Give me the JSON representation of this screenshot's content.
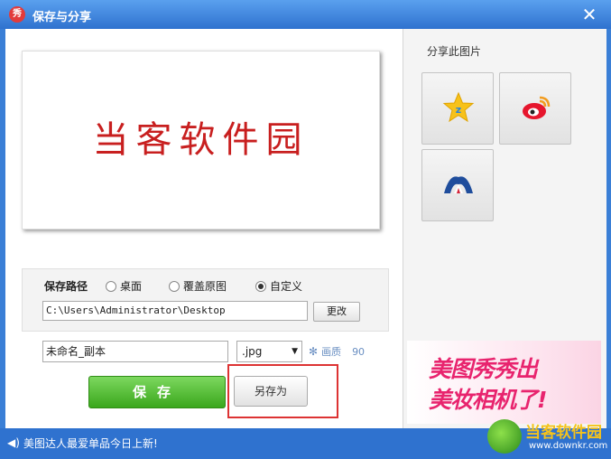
{
  "window": {
    "title": "保存与分享",
    "logo_char": "秀",
    "close_glyph": "✕"
  },
  "preview": {
    "image_text": "当客软件园"
  },
  "save_path": {
    "label": "保存路径",
    "options": [
      {
        "label": "桌面",
        "selected": false
      },
      {
        "label": "覆盖原图",
        "selected": false
      },
      {
        "label": "自定义",
        "selected": true
      }
    ],
    "path_value": "C:\\Users\\Administrator\\Desktop",
    "change_label": "更改"
  },
  "file": {
    "name_value": "未命名_副本",
    "format_value": ".jpg",
    "quality_label": "画质",
    "quality_value": "90"
  },
  "actions": {
    "save_label": "保存",
    "save_as_label": "另存为"
  },
  "share": {
    "title": "分享此图片",
    "targets": [
      "qzone-icon",
      "weibo-icon",
      "renren-icon"
    ]
  },
  "ad": {
    "line1": "美图秀秀出",
    "line2": "美妆相机了!"
  },
  "status": {
    "text": "美图达人最爱单品今日上新!"
  },
  "watermark": {
    "title": "当客软件园",
    "url": "www.downkr.com"
  },
  "colors": {
    "title_bar": "#3a7fd6",
    "save_green": "#3aa71c",
    "highlight_red": "#dd3333",
    "ad_pink": "#e8246e"
  }
}
